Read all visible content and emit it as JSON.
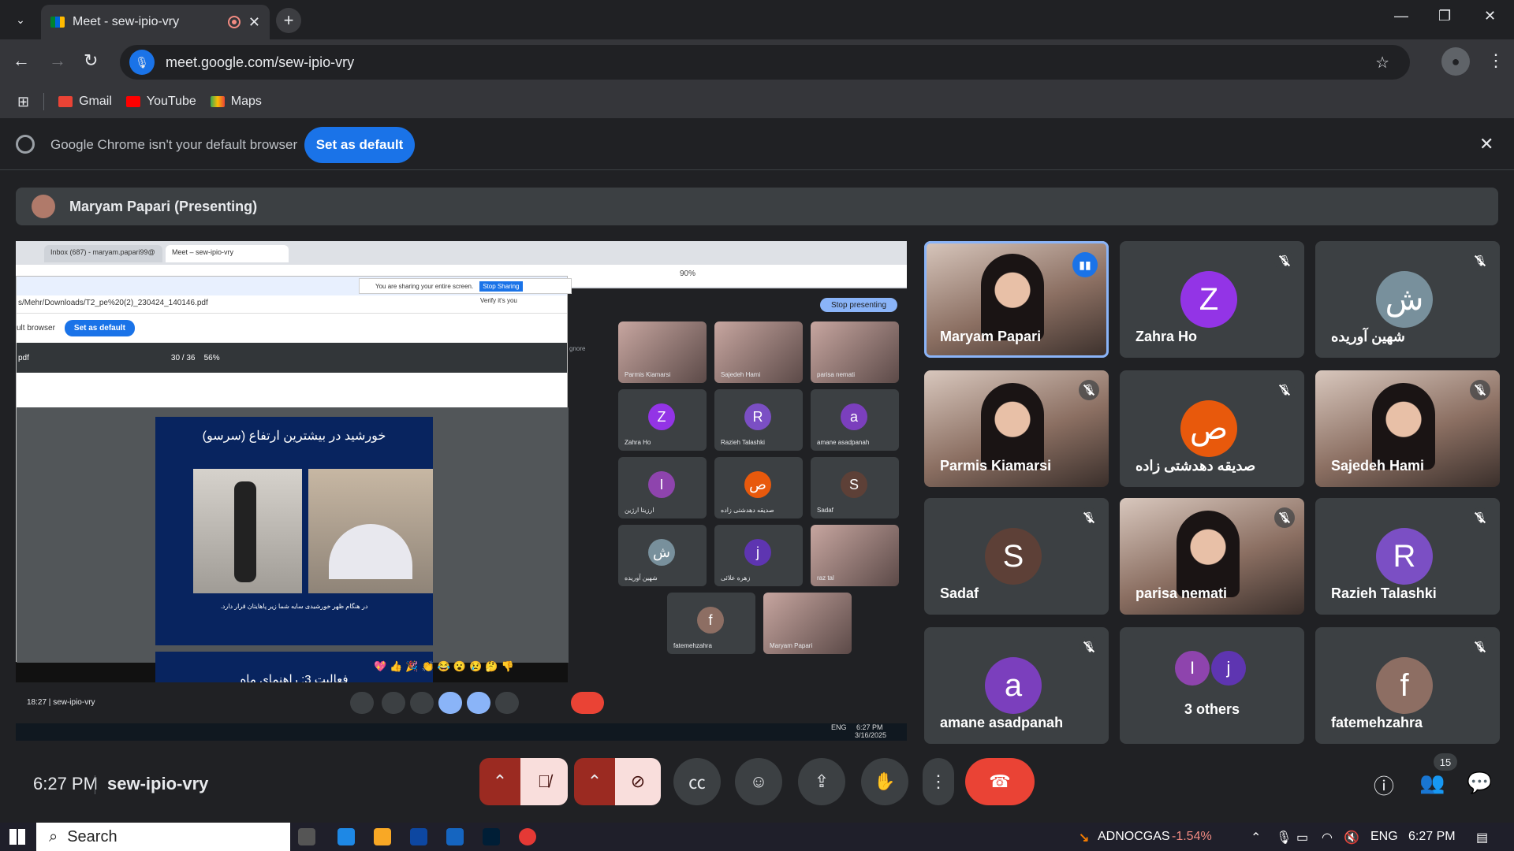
{
  "tab": {
    "title": "Meet - sew-ipio-vry"
  },
  "address": {
    "url": "meet.google.com/sew-ipio-vry"
  },
  "bookmarks": [
    "Gmail",
    "YouTube",
    "Maps"
  ],
  "banner": {
    "message": "Google Chrome isn't your default browser",
    "button": "Set as default"
  },
  "presenter": {
    "label": "Maryam Papari (Presenting)"
  },
  "shared": {
    "tabs": [
      "Inbox (687) - maryam.papari99@",
      "Meet – sew-ipio-vry"
    ],
    "zoom": "90%",
    "sharing_notice": "You are sharing your entire screen.",
    "stop_sharing": "Stop Sharing",
    "pdf_path": "s/Mehr/Downloads/T2_pe%20(2)_230424_140146.pdf",
    "verify": "Verify it's you",
    "default_msg": "ult browser",
    "default_btn": "Set as default",
    "pdf_label": "pdf",
    "pdf_pages": "30 / 36",
    "pdf_zoom": "56%",
    "slide_title": "خورشید در بیشترین ارتفاع (سرسو)",
    "slide_caption": "در هنگام ظهر خورشیدی سایه شما زیر پاهایتان قرار دارد.",
    "slide2_title": "فعالیت 3: راهنمای ماه",
    "stop_presenting": "Stop presenting",
    "ignore": "gnore",
    "mini_tiles": [
      {
        "name": "Parmis Kiamarsi",
        "letter": ""
      },
      {
        "name": "Sajedeh Hami",
        "letter": ""
      },
      {
        "name": "parisa nemati",
        "letter": ""
      },
      {
        "name": "Zahra Ho",
        "letter": "Z",
        "color": "#9334e6"
      },
      {
        "name": "Razieh Talashki",
        "letter": "R",
        "color": "#7b4fc4"
      },
      {
        "name": "amane asadpanah",
        "letter": "a",
        "color": "#7b3fbd"
      },
      {
        "name": "ارزیتا ارژین",
        "letter": "I",
        "color": "#8e44ad"
      },
      {
        "name": "صدیقه دهدشتی زاده",
        "letter": "ص",
        "color": "#e8590c"
      },
      {
        "name": "Sadaf",
        "letter": "S",
        "color": "#5d4037"
      },
      {
        "name": "شهین آوریده",
        "letter": "ش",
        "color": "#78909c"
      },
      {
        "name": "زهره علائی",
        "letter": "j",
        "color": "#5e35b1"
      },
      {
        "name": "raz tal",
        "letter": ""
      },
      {
        "name": "fatemehzahra",
        "letter": "f",
        "color": "#8d6e63"
      },
      {
        "name": "Maryam Papari",
        "letter": ""
      }
    ],
    "emoji": "💖👍🎉👏😂😮😢🤔👎",
    "meet_time": "18:27",
    "meet_code": "sew-ipio-vry",
    "task_time": "6:27 PM",
    "task_date": "3/16/2025",
    "task_lang": "ENG"
  },
  "participants": [
    {
      "name": "Maryam Papari",
      "type": "video",
      "speaking": true
    },
    {
      "name": "Zahra Ho",
      "letter": "Z",
      "color": "#9334e6"
    },
    {
      "name": "شهین آوریده",
      "letter": "ش",
      "color": "#78909c"
    },
    {
      "name": "Parmis Kiamarsi",
      "type": "video"
    },
    {
      "name": "صدیقه دهدشتی زاده",
      "letter": "ص",
      "color": "#e8590c"
    },
    {
      "name": "Sajedeh Hami",
      "type": "video"
    },
    {
      "name": "Sadaf",
      "letter": "S",
      "color": "#5d4037"
    },
    {
      "name": "parisa nemati",
      "type": "video"
    },
    {
      "name": "Razieh Talashki",
      "letter": "R",
      "color": "#7b4fc4"
    },
    {
      "name": "amane asadpanah",
      "letter": "a",
      "color": "#7b3fbd"
    },
    {
      "name": "3 others",
      "letters": [
        "I",
        "j"
      ]
    },
    {
      "name": "fatemehzahra",
      "letter": "f",
      "color": "#8d6e63"
    }
  ],
  "meetbar": {
    "time": "6:27 PM",
    "code": "sew-ipio-vry",
    "participant_count": "15"
  },
  "taskbar": {
    "search": "Search",
    "stock_name": "ADNOCGAS",
    "stock_change": "-1.54%",
    "lang": "ENG",
    "time": "6:27 PM"
  },
  "colors": {
    "accent": "#1a73e8",
    "end_call": "#ea4335",
    "muted_red": "#9b2a21",
    "stock_down": "#f28b82"
  }
}
